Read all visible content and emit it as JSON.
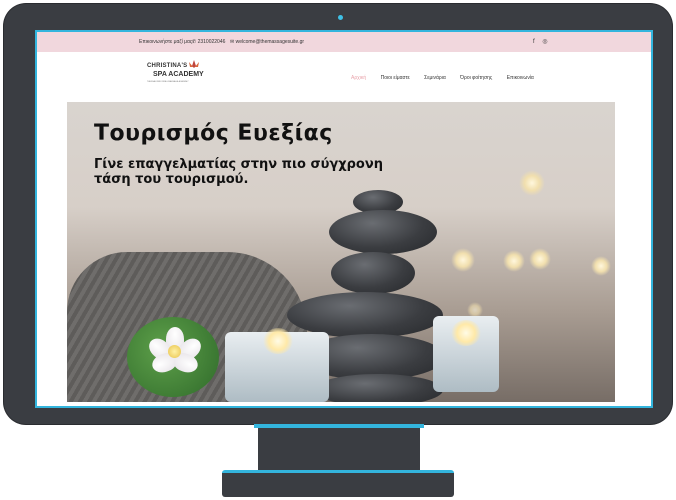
{
  "topbar": {
    "contact_label": "Επικοινωνήστε μαζί μας:",
    "phone": "2310022046",
    "email": "welcome@themassagesuite.gr",
    "social_icons": [
      "facebook-icon",
      "instagram-icon"
    ]
  },
  "header": {
    "logo_line1": "CHRISTINA'S",
    "logo_line2": "SPA ACADEMY",
    "logo_tagline": "THESSALONIKI SPA & MASSAGE ACADEMY",
    "nav": [
      "Αρχική",
      "Ποιοι είμαστε",
      "Σεμινάρια",
      "Όροι φοίτησης",
      "Επικοινωνία"
    ],
    "active_nav": "Αρχική"
  },
  "hero": {
    "title": "Τουρισμός Ευεξίας",
    "subtitle": "Γίνε επαγγελματίας στην πιο σύγχρονη τάση του τουρισμού."
  },
  "colors": {
    "accent": "#33b5dd",
    "topbar_bg": "#f1d7dd",
    "nav_active": "#e9a3ab",
    "monitor": "#3a3d42"
  }
}
